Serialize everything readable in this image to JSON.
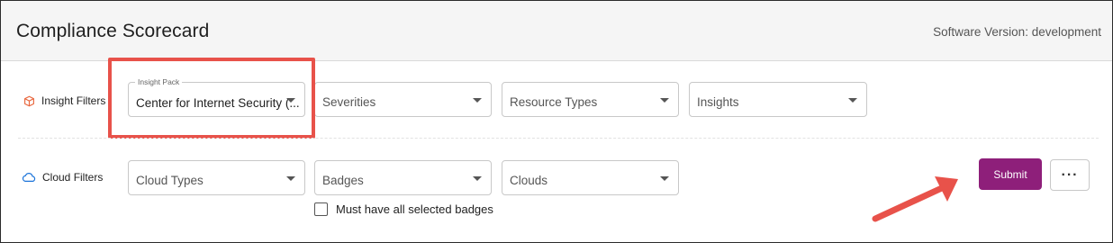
{
  "header": {
    "title": "Compliance Scorecard",
    "version": "Software Version: development"
  },
  "insight_filters": {
    "label": "Insight Filters",
    "icon": "cube-icon",
    "icon_color": "#e8643a",
    "insight_pack": {
      "label": "Insight Pack",
      "value": "Center for Internet Security (..."
    },
    "severities": {
      "placeholder": "Severities"
    },
    "resource_types": {
      "placeholder": "Resource Types"
    },
    "insights": {
      "placeholder": "Insights"
    }
  },
  "cloud_filters": {
    "label": "Cloud Filters",
    "icon": "cloud-icon",
    "icon_color": "#1a73d9",
    "cloud_types": {
      "placeholder": "Cloud Types"
    },
    "badges": {
      "placeholder": "Badges"
    },
    "clouds": {
      "placeholder": "Clouds"
    },
    "must_have_all_badges": {
      "label": "Must have all selected badges",
      "checked": false
    }
  },
  "actions": {
    "submit_label": "Submit",
    "more_label": "···",
    "submit_color": "#8e1f7a"
  },
  "annotation": {
    "highlight_color": "#e8524a"
  }
}
